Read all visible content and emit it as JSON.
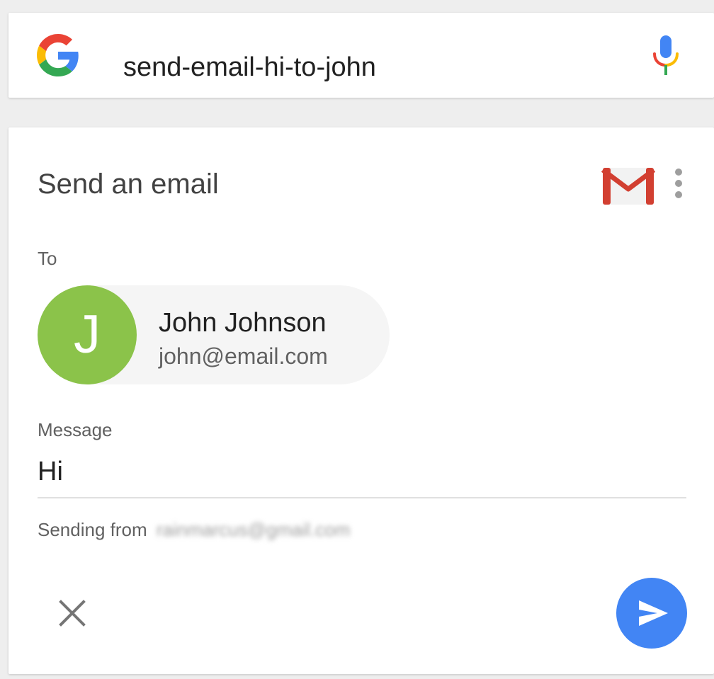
{
  "search": {
    "query": "send-email-hi-to-john",
    "logo_icon": "google-g-icon",
    "mic_icon": "microphone-icon"
  },
  "card": {
    "title": "Send an email",
    "app_icon": "gmail-icon",
    "menu_icon": "more-vert-icon",
    "to_label": "To",
    "contact": {
      "avatar_initial": "J",
      "avatar_color": "#8bc34a",
      "name": "John Johnson",
      "email": "john@email.com"
    },
    "message_label": "Message",
    "message_value": "Hi",
    "sending_from_label": "Sending from",
    "sender_email": "rainmarcus@gmail.com",
    "close_icon": "close-icon",
    "send_icon": "send-icon"
  },
  "colors": {
    "accent": "#4285f4",
    "google_blue": "#4285f4",
    "google_red": "#ea4335",
    "google_yellow": "#fbbc05",
    "google_green": "#34a853"
  }
}
